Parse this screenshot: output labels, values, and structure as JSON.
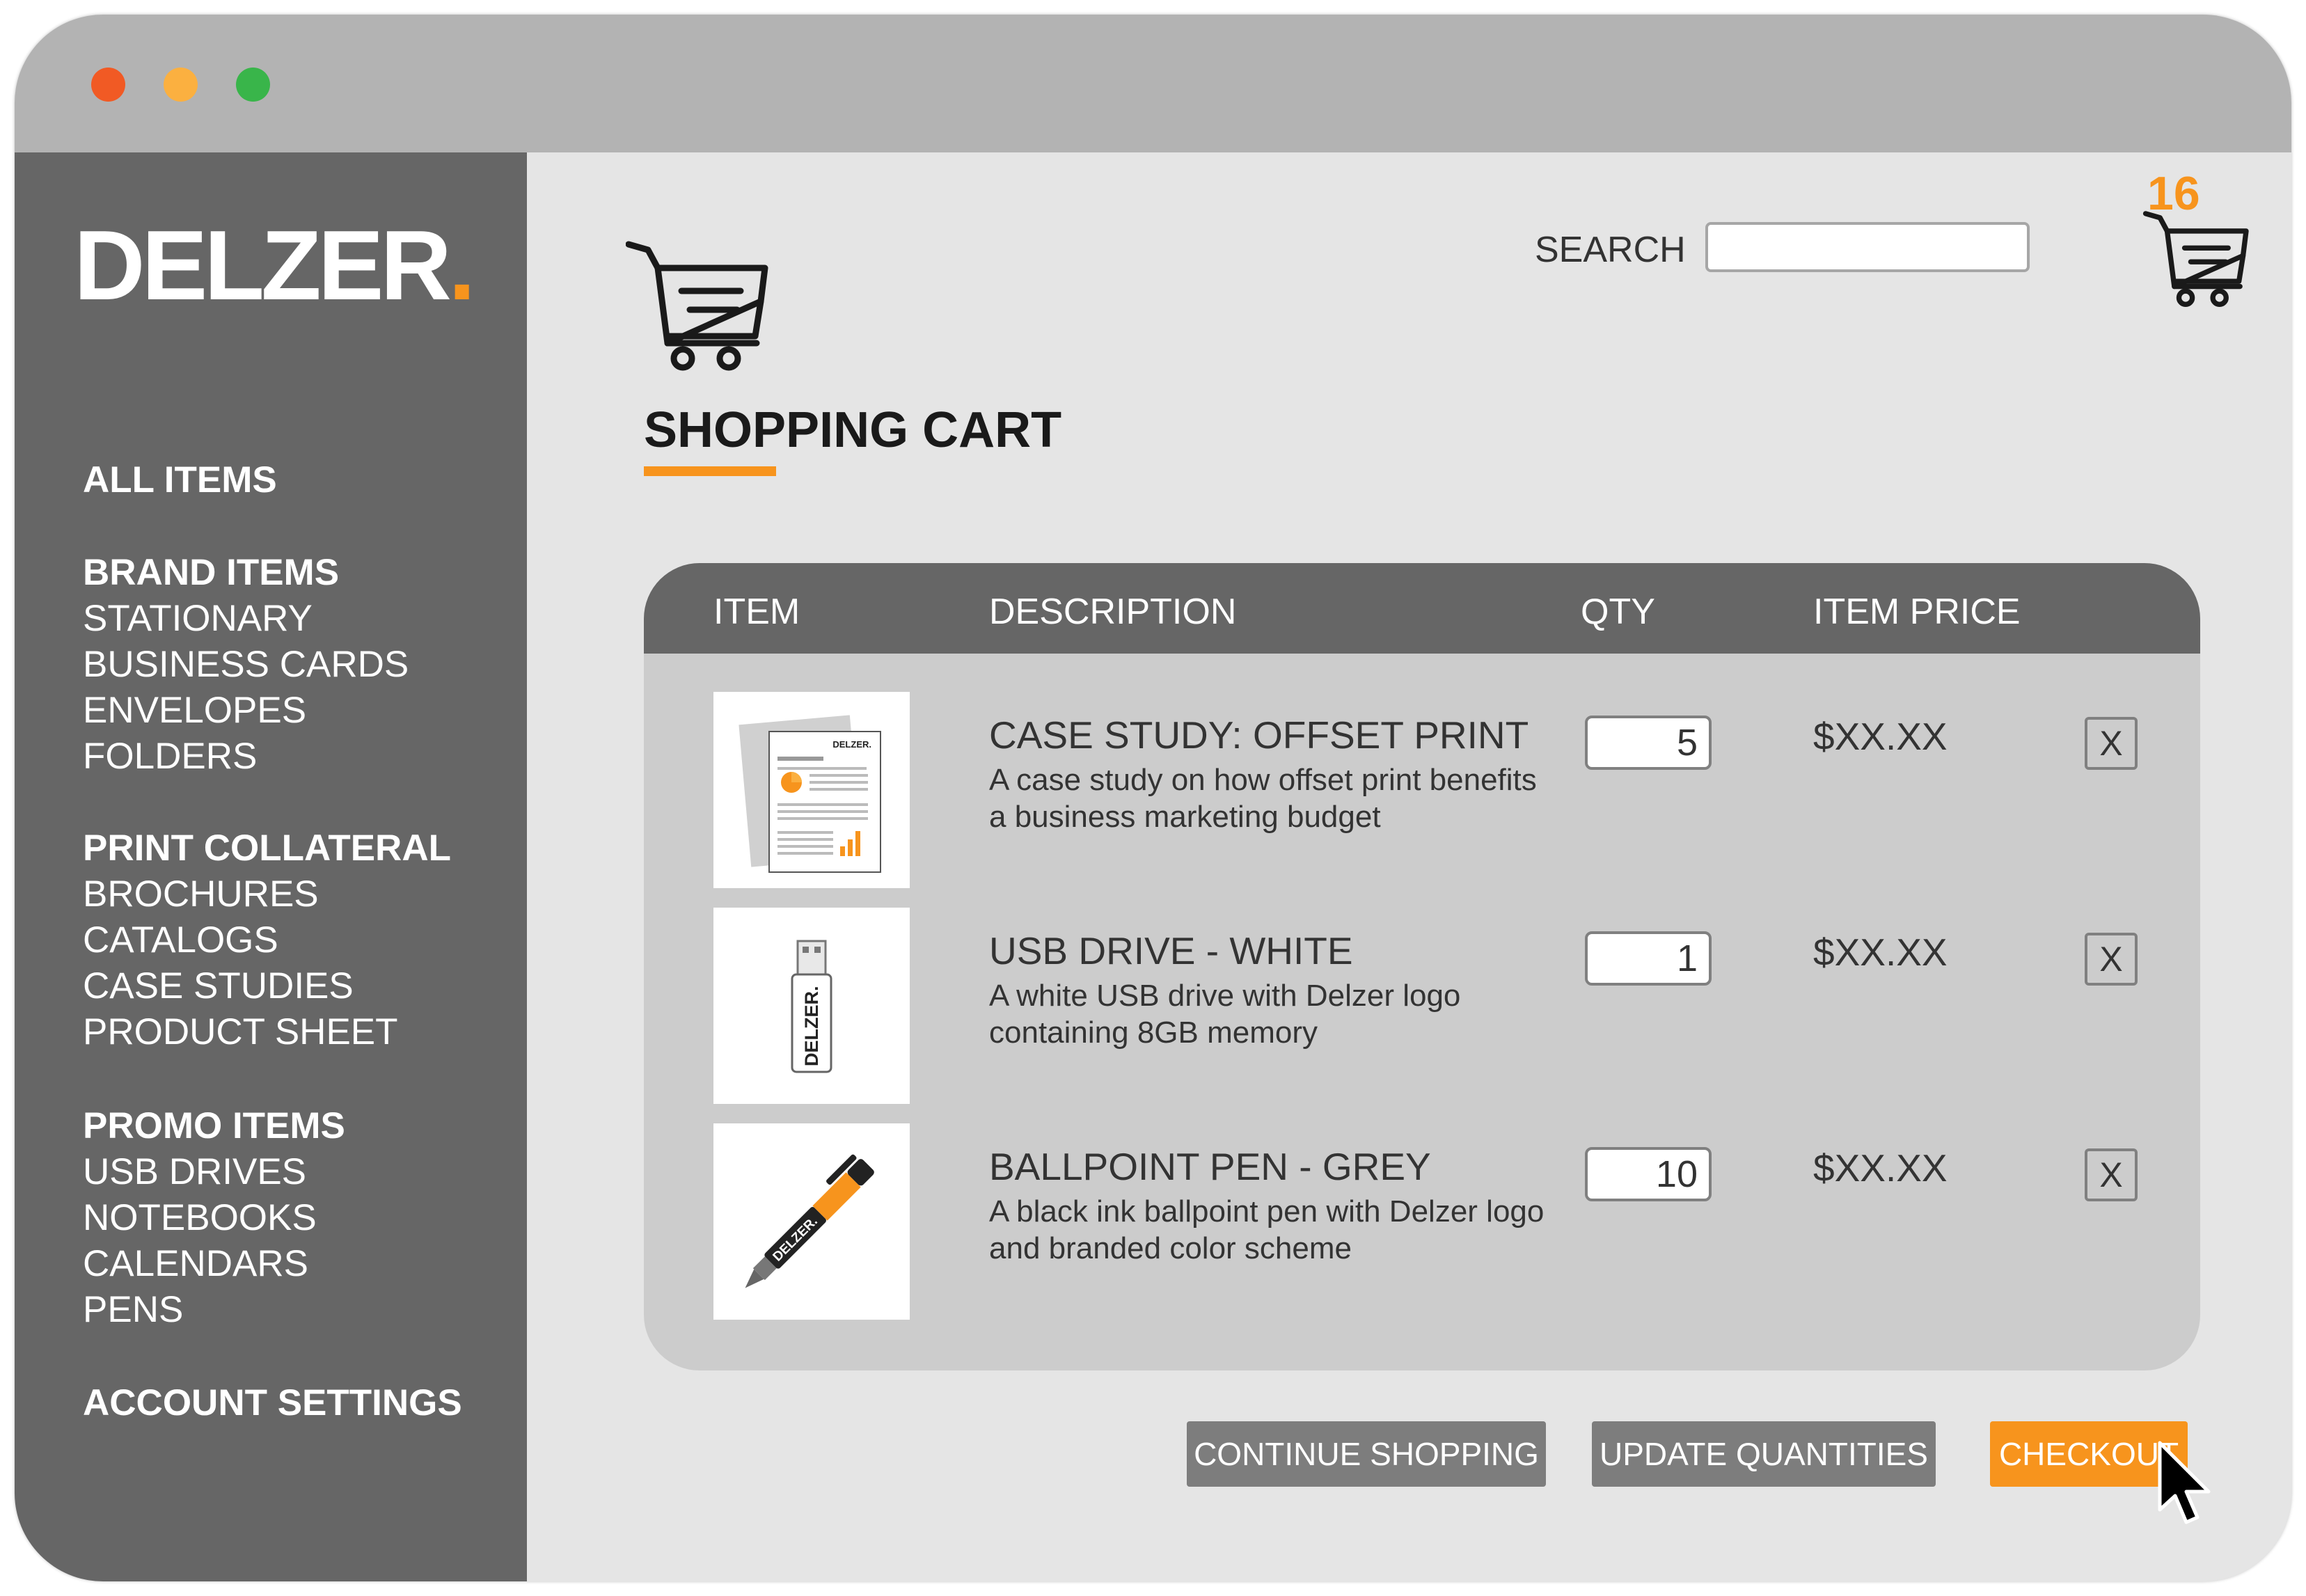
{
  "window": {
    "controls": [
      "close",
      "minimize",
      "maximize"
    ],
    "colors": {
      "close": "#f15a24",
      "minimize": "#fbb040",
      "maximize": "#39b54a"
    }
  },
  "brand": {
    "name": "DELZER",
    "dot": ".",
    "accent": "#f7941d"
  },
  "sidebar": {
    "all_items": "ALL ITEMS",
    "groups": [
      {
        "heading": "BRAND ITEMS",
        "items": [
          "STATIONARY",
          "BUSINESS CARDS",
          "ENVELOPES",
          "FOLDERS"
        ]
      },
      {
        "heading": "PRINT COLLATERAL",
        "items": [
          "BROCHURES",
          "CATALOGS",
          "CASE STUDIES",
          "PRODUCT SHEET"
        ]
      },
      {
        "heading": "PROMO ITEMS",
        "items": [
          "USB DRIVES",
          "NOTEBOOKS",
          "CALENDARS",
          "PENS"
        ]
      }
    ],
    "account_settings": "ACCOUNT SETTINGS"
  },
  "header": {
    "search_label": "SEARCH",
    "search_value": "",
    "cart_count": "16",
    "cart_icon": "shopping-cart-icon"
  },
  "page": {
    "title": "SHOPPING CART"
  },
  "table": {
    "columns": [
      "ITEM",
      "DESCRIPTION",
      "QTY",
      "ITEM PRICE"
    ],
    "rows": [
      {
        "name": "CASE STUDY: OFFSET PRINT",
        "description": "A case study on how offset print benefits a business marketing budget",
        "qty": "5",
        "price": "$XX.XX",
        "remove": "X",
        "thumb_icon": "case-study-document-icon",
        "thumb_brand": "DELZER."
      },
      {
        "name": "USB DRIVE - WHITE",
        "description": "A white USB drive with Delzer logo containing 8GB memory",
        "qty": "1",
        "price": "$XX.XX",
        "remove": "X",
        "thumb_icon": "usb-drive-icon",
        "thumb_brand": "DELZER."
      },
      {
        "name": "BALLPOINT PEN - GREY",
        "description": "A black ink ballpoint pen with Delzer logo and branded color scheme",
        "qty": "10",
        "price": "$XX.XX",
        "remove": "X",
        "thumb_icon": "ballpoint-pen-icon",
        "thumb_brand": "DELZER."
      }
    ]
  },
  "actions": {
    "continue_shopping": "CONTINUE SHOPPING",
    "update_quantities": "UPDATE QUANTITIES",
    "checkout": "CHECKOUT"
  }
}
